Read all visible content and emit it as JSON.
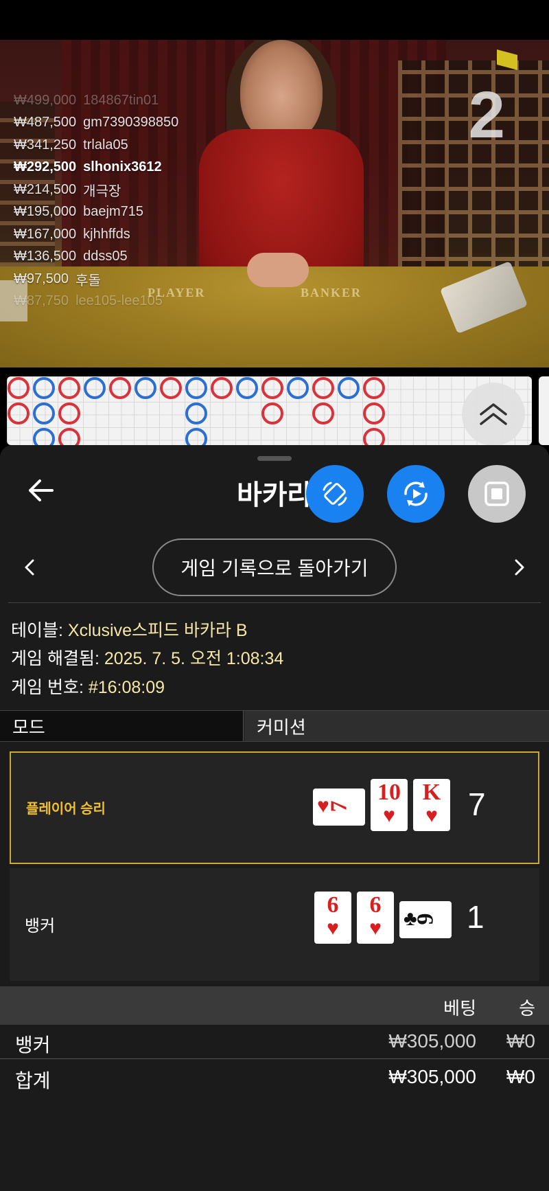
{
  "video": {
    "leaderboard": [
      {
        "amount": "₩499,000",
        "user": "184867tin01",
        "faded": true,
        "bold": false
      },
      {
        "amount": "₩487,500",
        "user": "gm7390398850",
        "faded": false,
        "bold": false
      },
      {
        "amount": "₩341,250",
        "user": "trlala05",
        "faded": false,
        "bold": false
      },
      {
        "amount": "₩292,500",
        "user": "slhonix3612",
        "faded": false,
        "bold": true
      },
      {
        "amount": "₩214,500",
        "user": "개극장",
        "faded": false,
        "bold": false
      },
      {
        "amount": "₩195,000",
        "user": "baejm715",
        "faded": false,
        "bold": false
      },
      {
        "amount": "₩167,000",
        "user": "kjhhffds",
        "faded": false,
        "bold": false
      },
      {
        "amount": "₩136,500",
        "user": "ddss05",
        "faded": false,
        "bold": false
      },
      {
        "amount": "₩97,500",
        "user": "후돌",
        "faded": false,
        "bold": false
      },
      {
        "amount": "₩87,750",
        "user": "lee105-lee105",
        "faded": true,
        "bold": false
      }
    ],
    "countdown": "2",
    "felt_player": "PLAYER",
    "felt_banker": "BANKER"
  },
  "roadmap": {
    "columns": [
      [
        "red",
        "red",
        null
      ],
      [
        "blue",
        "blue",
        "blue"
      ],
      [
        "red",
        "red",
        "red"
      ],
      [
        "blue",
        null,
        null
      ],
      [
        "red",
        null,
        null
      ],
      [
        "blue",
        null,
        null
      ],
      [
        "red",
        null,
        null
      ],
      [
        "blue",
        "blue",
        "blue"
      ],
      [
        "red",
        null,
        null
      ],
      [
        "blue",
        null,
        null
      ],
      [
        "red",
        "red",
        null
      ],
      [
        "blue",
        null,
        null
      ],
      [
        "red",
        "red",
        null
      ],
      [
        "blue",
        null,
        null
      ],
      [
        "red",
        "red",
        "red"
      ]
    ],
    "colors": {
      "red": "#d8323a",
      "blue": "#2c6fd0"
    }
  },
  "sheet": {
    "title": "바카라",
    "history_button": "게임 기록으로 돌아가기",
    "info": {
      "table_label": "테이블: ",
      "table_value": "Xclusive스피드 바카라 B",
      "resolved_label": "게임 해결됨: ",
      "resolved_value": "2025. 7. 5. 오전 1:08:34",
      "number_label": "게임 번호: ",
      "number_value": "#16:08:09"
    },
    "tabs": {
      "mode": "모드",
      "commission": "커미션"
    },
    "player": {
      "label": "플레이어 승리",
      "score": "7",
      "cards": [
        {
          "rank": "7",
          "suit": "♥",
          "color": "red",
          "sideways": true
        },
        {
          "rank": "10",
          "suit": "♥",
          "color": "red",
          "sideways": false
        },
        {
          "rank": "K",
          "suit": "♥",
          "color": "red",
          "sideways": false
        }
      ]
    },
    "banker": {
      "label": "뱅커",
      "score": "1",
      "cards": [
        {
          "rank": "6",
          "suit": "♥",
          "color": "red",
          "sideways": false
        },
        {
          "rank": "6",
          "suit": "♥",
          "color": "red",
          "sideways": false
        },
        {
          "rank": "9",
          "suit": "♣",
          "color": "black",
          "sideways": true
        }
      ]
    },
    "bets": {
      "head_bet": "베팅",
      "head_win": "승",
      "rows": [
        {
          "name": "뱅커",
          "amount": "₩305,000",
          "win": "₩0"
        }
      ],
      "total": {
        "name": "합계",
        "amount": "₩305,000",
        "win": "₩0"
      }
    },
    "icons": {
      "back": "back-arrow-icon",
      "rotate": "rotate-screen-icon",
      "video": "video-play-icon",
      "stop": "stop-icon",
      "collapse": "double-chevron-up-icon"
    },
    "accent": "#1a82f0",
    "highlight": "#c9a92f"
  }
}
